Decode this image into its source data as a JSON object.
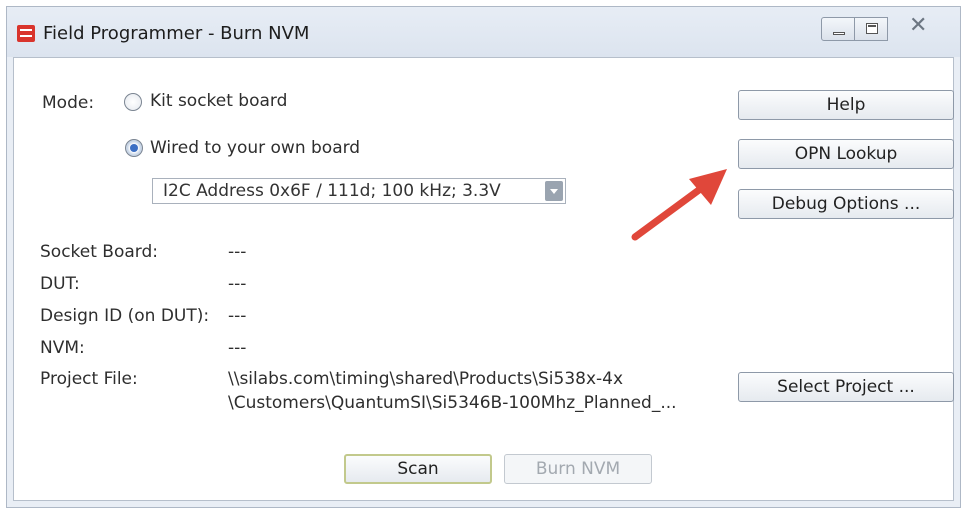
{
  "window": {
    "title": "Field Programmer - Burn NVM",
    "close_glyph": "✕"
  },
  "mode": {
    "label": "Mode:",
    "options": [
      {
        "label": "Kit socket board",
        "selected": false
      },
      {
        "label": "Wired to your own board",
        "selected": true
      }
    ],
    "address_select": {
      "value": "I2C Address 0x6F / 111d; 100 kHz; 3.3V"
    }
  },
  "info": {
    "socket_board": {
      "label": "Socket Board:",
      "value": "---"
    },
    "dut": {
      "label": "DUT:",
      "value": "---"
    },
    "design_id": {
      "label": "Design ID (on DUT):",
      "value": "---"
    },
    "nvm": {
      "label": "NVM:",
      "value": "---"
    },
    "project_file": {
      "label": "Project File:",
      "line1": "\\\\silabs.com\\timing\\shared\\Products\\Si538x-4x",
      "line2": "\\Customers\\QuantumSI\\Si5346B-100Mhz_Planned_..."
    }
  },
  "buttons": {
    "help": "Help",
    "opn_lookup": "OPN Lookup",
    "debug_options": "Debug Options ...",
    "select_project": "Select Project ...",
    "scan": "Scan",
    "burn_nvm": "Burn NVM"
  },
  "colors": {
    "annotation_arrow": "#e0473a",
    "radio_checked": "#3c6fc4",
    "scan_border": "#c2c98c"
  },
  "icons": {
    "app": "app-logo-icon",
    "annotation": "red-arrow-icon"
  }
}
